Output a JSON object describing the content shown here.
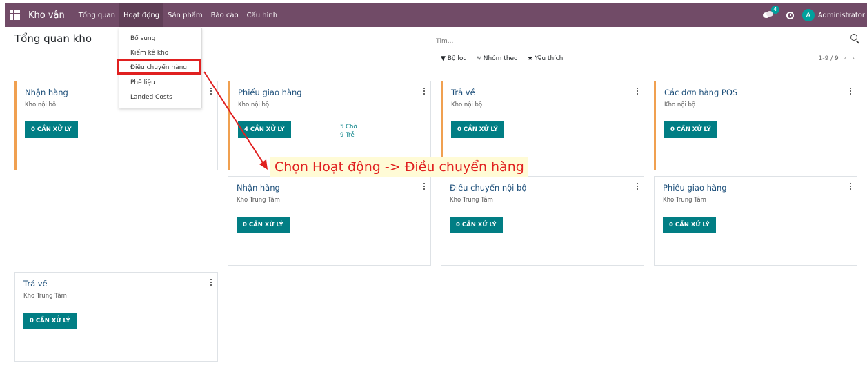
{
  "navbar": {
    "app_title": "Kho vận",
    "menu": [
      "Tổng quan",
      "Hoạt động",
      "Sản phẩm",
      "Báo cáo",
      "Cấu hình"
    ],
    "chat_count": "4",
    "avatar_letter": "A",
    "user": "Administrator"
  },
  "control_panel": {
    "title": "Tổng quan kho",
    "search_placeholder": "Tìm...",
    "filter": "Bộ lọc",
    "group_by": "Nhóm theo",
    "favorites": "Yêu thích",
    "pager": "1-9 / 9",
    "prev": "‹",
    "next": "›"
  },
  "dropdown": {
    "items": [
      "Bổ sung",
      "Kiểm kê kho",
      "Điều chuyển hàng",
      "Phế liệu",
      "Landed Costs"
    ]
  },
  "cards": [
    {
      "title": "Nhận hàng",
      "subtitle": "Kho nội bộ",
      "button": "0 CẦN XỬ LÝ"
    },
    {
      "title": "Phiếu giao hàng",
      "subtitle": "Kho nội bộ",
      "button": "4 CẦN XỬ LÝ",
      "stat1": "5 Chờ",
      "stat2": "9 Trễ"
    },
    {
      "title": "Trả về",
      "subtitle": "Kho nội bộ",
      "button": "0 CẦN XỬ LÝ"
    },
    {
      "title": "Các đơn hàng POS",
      "subtitle": "Kho nội bộ",
      "button": "0 CẦN XỬ LÝ"
    },
    {
      "title": "Nhận hàng",
      "subtitle": "Kho Trung Tâm",
      "button": "0 CẦN XỬ LÝ"
    },
    {
      "title": "Điều chuyển nội bộ",
      "subtitle": "Kho Trung Tâm",
      "button": "0 CẦN XỬ LÝ"
    },
    {
      "title": "Phiếu giao hàng",
      "subtitle": "Kho Trung Tâm",
      "button": "0 CẦN XỬ LÝ"
    },
    {
      "title": "Trả về",
      "subtitle": "Kho Trung Tâm",
      "button": "0 CẦN XỬ LÝ"
    }
  ],
  "annotation": "Chọn Hoạt động -> Điều chuyển hàng",
  "colors": {
    "navbar": "#714b67",
    "button": "#017e84",
    "accent_border": "#f0a050",
    "highlight": "#e02020",
    "annotation_bg": "#fffbd6"
  }
}
